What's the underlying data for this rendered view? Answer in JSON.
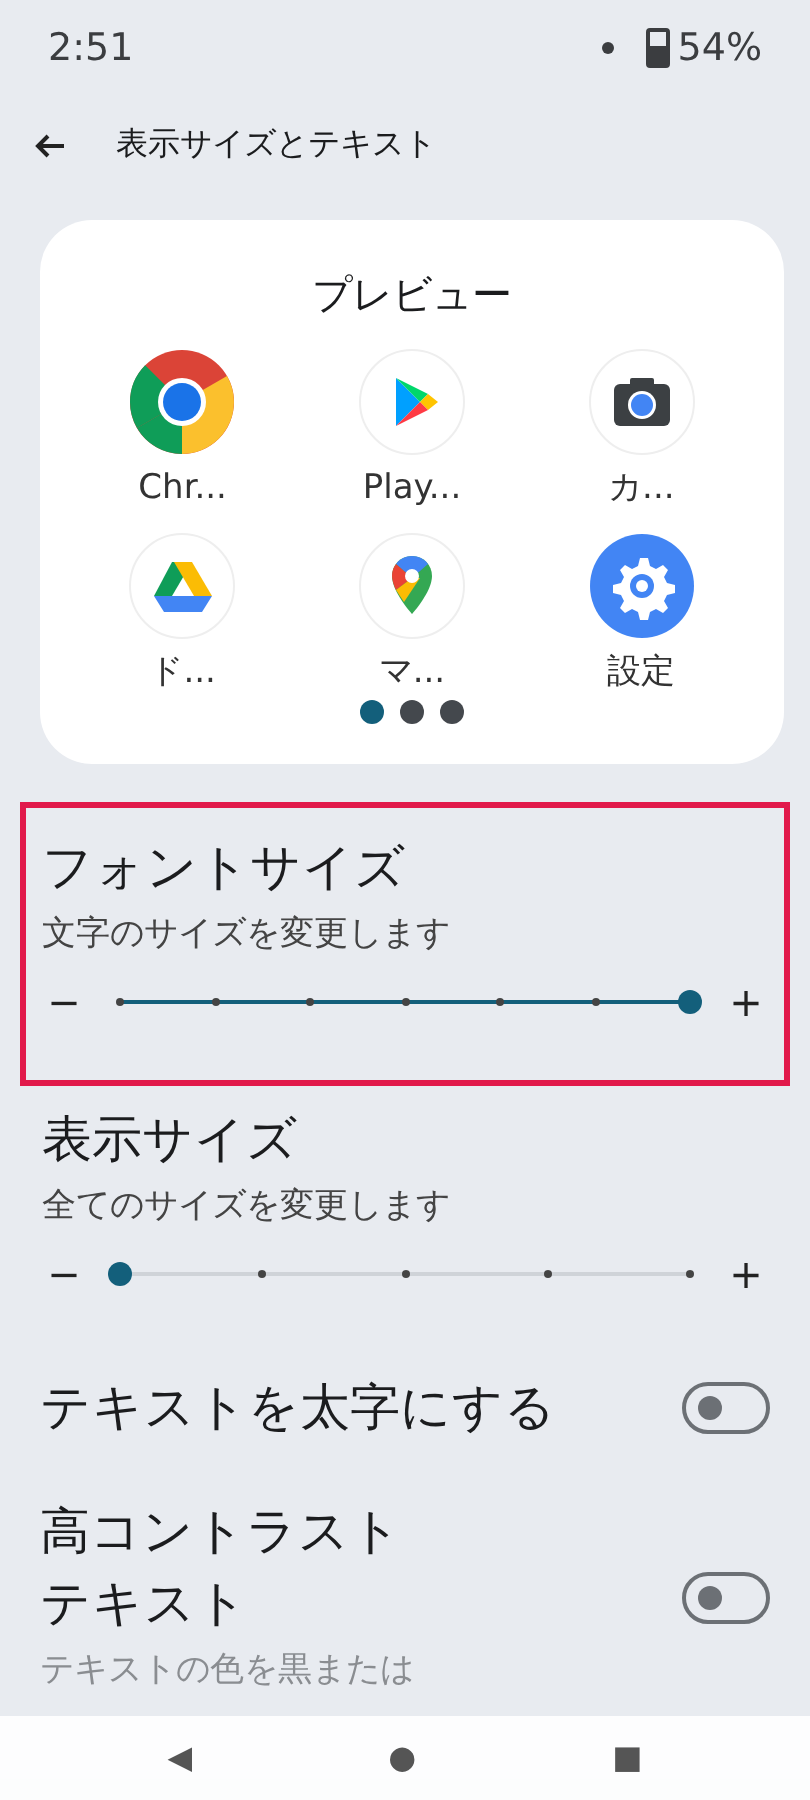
{
  "status_bar": {
    "time": "2:51",
    "battery": "54%"
  },
  "app_bar": {
    "title": "表示サイズとテキスト"
  },
  "preview": {
    "title": "プレビュー",
    "apps": [
      {
        "kind": "chrome",
        "label": "Chr..."
      },
      {
        "kind": "play",
        "label": "Play..."
      },
      {
        "kind": "camera",
        "label": "カ..."
      },
      {
        "kind": "drive",
        "label": "ド..."
      },
      {
        "kind": "maps",
        "label": "マ..."
      },
      {
        "kind": "settings",
        "label": "設定"
      }
    ],
    "pages": [
      {
        "selected": true
      },
      {
        "selected": false
      },
      {
        "selected": false
      }
    ]
  },
  "settings": [
    {
      "kind": "slider",
      "title": "フォントサイズ",
      "subtitle": "文字のサイズを変更します",
      "highlighted": true,
      "stops": [
        {
          "selected": false
        },
        {
          "selected": false
        },
        {
          "selected": false
        },
        {
          "selected": false
        },
        {
          "selected": false
        },
        {
          "selected": false
        },
        {
          "selected": true
        }
      ],
      "minus": "−",
      "plus": "+"
    },
    {
      "kind": "slider",
      "title": "表示サイズ",
      "subtitle": "全てのサイズを変更します",
      "highlighted": false,
      "stops": [
        {
          "selected": true
        },
        {
          "selected": false
        },
        {
          "selected": false
        },
        {
          "selected": false
        },
        {
          "selected": false
        }
      ],
      "minus": "−",
      "plus": "+"
    },
    {
      "kind": "toggle",
      "title": "テキストを太字にする",
      "on": false
    },
    {
      "kind": "toggle",
      "title_lines": [
        "高コントラスト",
        "テキスト"
      ],
      "subtitle": "テキストの色を黒または",
      "on": false
    }
  ],
  "nav_bar": {
    "back": "◀",
    "home": "●",
    "recents": "■"
  }
}
